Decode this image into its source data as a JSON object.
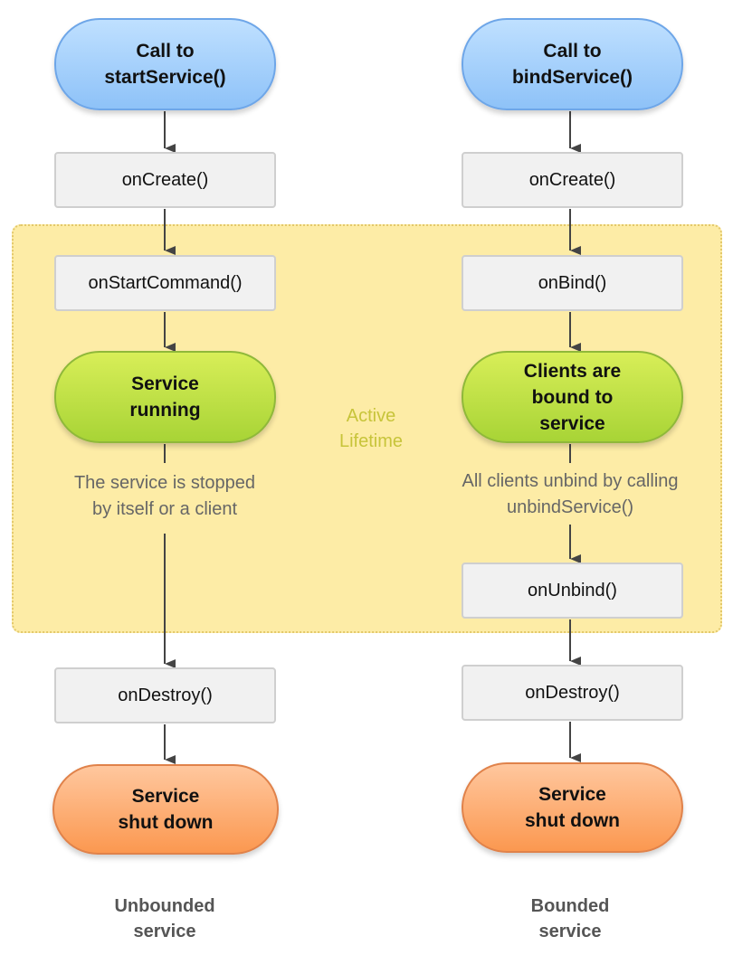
{
  "active_lifetime": {
    "line1": "Active",
    "line2": "Lifetime"
  },
  "unbounded": {
    "start": {
      "line1": "Call to",
      "line2": "startService()"
    },
    "on_create": "onCreate()",
    "on_start_command": "onStartCommand()",
    "running": {
      "line1": "Service",
      "line2": "running"
    },
    "stop_note": {
      "line1": "The service is stopped",
      "line2": "by itself or a client"
    },
    "on_destroy": "onDestroy()",
    "shut_down": {
      "line1": "Service",
      "line2": "shut down"
    },
    "caption": {
      "line1": "Unbounded",
      "line2": "service"
    }
  },
  "bounded": {
    "start": {
      "line1": "Call to",
      "line2": "bindService()"
    },
    "on_create": "onCreate()",
    "on_bind": "onBind()",
    "bound": {
      "line1": "Clients are",
      "line2": "bound to",
      "line3": "service"
    },
    "unbind_note": {
      "line1": "All clients unbind by calling",
      "line2": "unbindService()"
    },
    "on_unbind": "onUnbind()",
    "on_destroy": "onDestroy()",
    "shut_down": {
      "line1": "Service",
      "line2": "shut down"
    },
    "caption": {
      "line1": "Bounded",
      "line2": "service"
    }
  },
  "colors": {
    "start": "#9ccbfa",
    "running": "#bfe248",
    "shut_down": "#fdae78",
    "active_area": "#fdeca6",
    "method_box": "#f1f1f1"
  }
}
